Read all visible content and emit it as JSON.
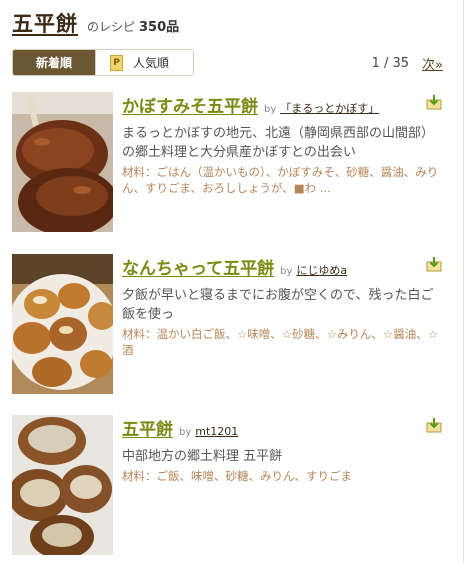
{
  "header": {
    "keyword": "五平餅",
    "suffix": "のレシピ",
    "count": "350品"
  },
  "sort": {
    "new_label": "新着順",
    "popular_label": "人気順",
    "popular_badge": "P"
  },
  "pager": {
    "text": "1 / 35",
    "next_label": "次»"
  },
  "recipes": [
    {
      "title": "かぼすみそ五平餅",
      "by": "by",
      "author": "「まるっとかぼす」",
      "description": "まるっとかぼすの地元、北遠（静岡県西部の山間部）の郷土料理と大分県産かぼすとの出会い",
      "ingredients": "材料：ごはん（温かいもの）、かぼすみそ、砂糖、醤油、みりん、すりごま、おろししょうが、■わ ..."
    },
    {
      "title": "なんちゃって五平餅",
      "by": "by",
      "author": "にじゆめa",
      "description": "夕飯が早いと寝るまでにお腹が空くので、残った白ご飯を使っ",
      "ingredients": "材料：温かい白ご飯、☆味噌、☆砂糖、☆みりん、☆醤油、☆酒"
    },
    {
      "title": "五平餅",
      "by": "by",
      "author": "mt1201",
      "description": "中部地方の郷土料理 五平餅",
      "ingredients": "材料：ご飯、味噌、砂糖、みりん、すりごま"
    }
  ],
  "colors": {
    "title": "#7a8a10",
    "active_tab": "#6b5733",
    "ingredients": "#b4875a"
  }
}
